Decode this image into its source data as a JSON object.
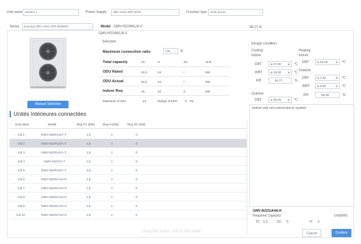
{
  "top": {
    "unit_name_label": "Unit name",
    "unit_name_value": "System 1",
    "power_supply_label": "Power Supply",
    "power_supply_value": "380~415V,3Ph,50Hz",
    "function_type_label": "Function type",
    "function_type_value": "Heat pump"
  },
  "series": {
    "label": "Series",
    "value": "al pump,380~415V-3Ph-50/60Hz",
    "model_label": "Model",
    "model_value": "GMV-H224WL/A-X",
    "ratio": "98,21 %"
  },
  "left": {
    "model_code": "GMV-H224WL/A-X",
    "selection_label": "Selection",
    "manual_selection": "Manual Selection"
  },
  "selection": {
    "max_ratio_label": "Maximum connection ratio",
    "max_ratio_value": "135",
    "max_ratio_unit": "%",
    "header": [
      "Total capacity",
      "TC",
      "H",
      "SC",
      "Unit"
    ],
    "rows": [
      {
        "label": "ODU Rated",
        "tc": "22,4",
        "h": "24",
        "sc": "/",
        "unit": "kW"
      },
      {
        "label": "ODU Actual",
        "tc": "22,4",
        "h": "24",
        "sc": "/",
        "unit": "kW"
      },
      {
        "label": "Indoor Req",
        "tc": "15",
        "h": "10",
        "sc": "0",
        "unit": "kW"
      }
    ],
    "max_idu_label": "Maximum of IDU:",
    "max_idu_value": "13",
    "esp_label": "Range of ESP:",
    "esp_value": "0",
    "esp_unit": "Pa"
  },
  "design": {
    "title": "Design condition",
    "cooling_label": "Cooling",
    "cooling_indoor_label": "Indoor",
    "heating_label": "Heating",
    "heating_indoor_label": "Indoor",
    "outdoor_label": "Outdoor",
    "cool_outdoor_label": "Outdoor",
    "dbt_label": "DBT",
    "wbt_label": "WBT",
    "rh_label": "RH",
    "cool_dbt": "27,00",
    "cool_wbt": "19,00",
    "cool_rh": "46,77",
    "heat_dbt": "20,00",
    "heat_out_dbt": "7,00",
    "heat_out_wbt": "6,00",
    "heat_out_rh": "85,95",
    "cool_out_dbt": "35,00",
    "deg_unit": "°C",
    "pct_unit": "%",
    "left_arrow": "◀",
    "right_arrow": "▶"
  },
  "units": {
    "title": "Unités Intérieures connectées",
    "columns": [
      "Unit name",
      "Model",
      "Req TC (kW)",
      "Req H (kW)",
      "Req SC (kW)"
    ],
    "rows": [
      [
        "Ind 1",
        "GMV-N22PLS/A-T",
        "1,5",
        "1",
        "0"
      ],
      [
        "Ind 2",
        "GMV-N22PLS/A-T",
        "1,5",
        "1",
        "0"
      ],
      [
        "Ind 3",
        "GMV-N22PLS/A-T",
        "1,5",
        "1",
        "0"
      ],
      [
        "Ind 4",
        "GMV-N22T/A-T",
        "1,5",
        "1",
        "0"
      ],
      [
        "Ind 5",
        "GMV-N22PLS/A-T",
        "1,5",
        "1",
        "0"
      ],
      [
        "Ind 6",
        "GMV-N22G/A4A-K",
        "1,5",
        "1",
        "0"
      ],
      [
        "Ind 7",
        "GMV-N22G/A4A-K",
        "1,5",
        "1",
        "0"
      ],
      [
        "Ind 8",
        "GMV-N22G/A4A-K",
        "1,5",
        "1",
        "0"
      ],
      [
        "Ind 9",
        "GMV-N22G/A4A-K",
        "1,5",
        "1",
        "0"
      ],
      [
        "Ind 10",
        "GMV-N22G/A4A-K",
        "1,5",
        "1",
        "0"
      ]
    ],
    "drag_hint": "Drag the indoor unit to this table"
  },
  "right_panel": {
    "header": "Indoor unit not connected to system",
    "model": "GMV-N22G/A4A-K",
    "req_cap_label": "Required Capacity",
    "unit_label": "Unit(kW)",
    "tc_label": "TC",
    "tc_value": "1,5",
    "sc_label": "SC",
    "sc_value": "0",
    "h_label": "H",
    "h_value": "1"
  },
  "buttons": {
    "cancel": "Cancel",
    "confirm": "Confirm"
  },
  "colors": {
    "accent": "#4a90e2",
    "selected_row": "#d7dade",
    "title_bar": "#4a90e2"
  }
}
